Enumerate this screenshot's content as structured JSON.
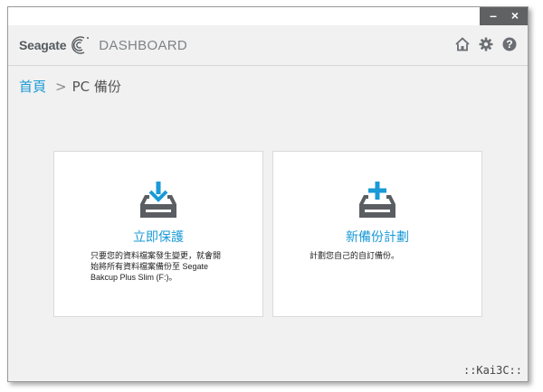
{
  "window": {
    "controls": {
      "minimize": "–",
      "close": "×"
    }
  },
  "header": {
    "brand": "Seagate",
    "app_name": "DASHBOARD",
    "icons": [
      "home-icon",
      "settings-gear-icon",
      "help-icon"
    ]
  },
  "breadcrumb": {
    "home": "首頁",
    "separator": ">",
    "current": "PC 備份"
  },
  "cards": [
    {
      "icon": "download-drive-icon",
      "title": "立即保護",
      "description": "只要您的資料檔案發生變更，就會開始將所有資料檔案備份至 Segate Bakcup Plus Slim (F:)。"
    },
    {
      "icon": "add-drive-icon",
      "title": "新備份計劃",
      "description": "計劃您自己的自訂備份。"
    }
  ],
  "watermark": "::Kai3C::",
  "colors": {
    "accent": "#1a9ad6",
    "titlebar_dark": "#5f6163",
    "icon_gray": "#5a5e62"
  }
}
